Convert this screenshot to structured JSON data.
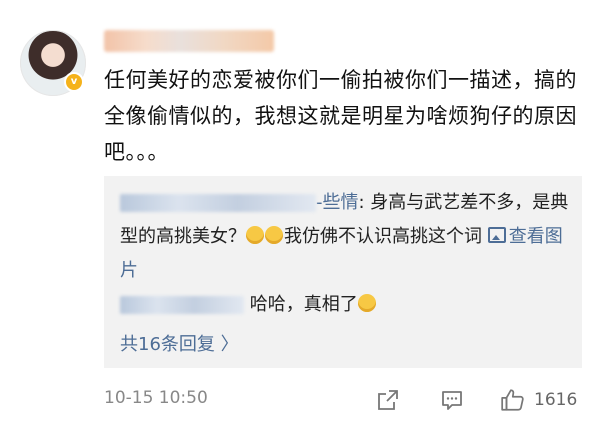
{
  "comment": {
    "text": "任何美好的恋爱被你们一偷拍被你们一描述，搞的全像偷情似的，我想这就是明星为啥烦狗仔的原因吧。。。"
  },
  "replies": [
    {
      "name_tail": "-些情",
      "text_part1": ": 身高与武艺差不多，是典型的高挑美女？",
      "text_part2": "我仿佛不认识高挑这个词",
      "view_image": "查看图片"
    },
    {
      "text": "哈哈，真相了"
    }
  ],
  "total_replies": "共16条回复 〉",
  "footer": {
    "timestamp": "10-15 10:50",
    "like_count": "1616"
  },
  "icons": {
    "verified_badge": "v-badge-icon",
    "share": "share-icon",
    "comment": "comment-icon",
    "like": "thumbs-up-icon",
    "picture": "picture-icon"
  },
  "colors": {
    "link": "#4d6d96",
    "reply_bg": "#f2f2f2",
    "badge": "#f5b21b"
  }
}
